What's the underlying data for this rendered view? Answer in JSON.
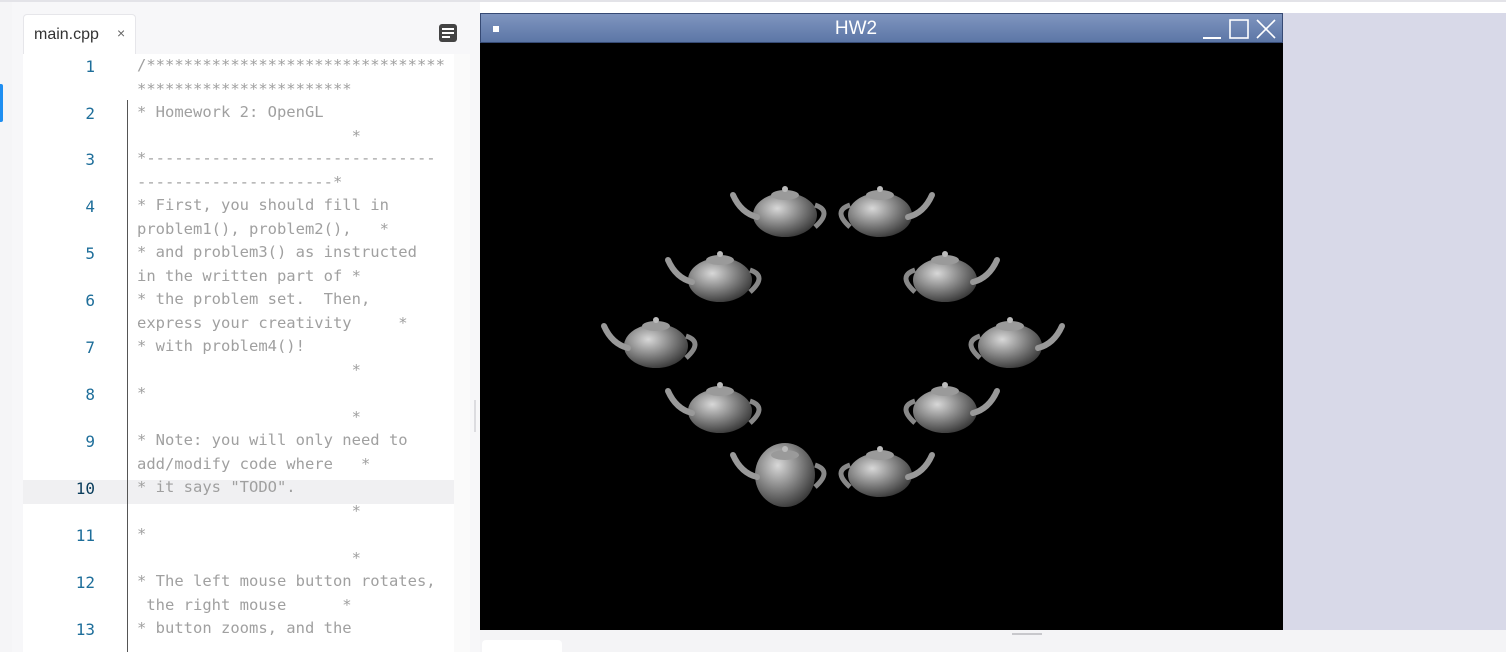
{
  "editor": {
    "tab_title": "main.cpp",
    "tab_close": "×",
    "outline_icon": "outline-icon",
    "active_line": "10",
    "lines": [
      {
        "num": "1",
        "text": "/********************************\n***********************"
      },
      {
        "num": "2",
        "text": "* Homework 2: OpenGL\n                       *"
      },
      {
        "num": "3",
        "text": "*-------------------------------\n---------------------*"
      },
      {
        "num": "4",
        "text": "* First, you should fill in\nproblem1(), problem2(),   *"
      },
      {
        "num": "5",
        "text": "* and problem3() as instructed\nin the written part of *"
      },
      {
        "num": "6",
        "text": "* the problem set.  Then,\nexpress your creativity     *"
      },
      {
        "num": "7",
        "text": "* with problem4()!\n                       *"
      },
      {
        "num": "8",
        "text": "*\n                       *"
      },
      {
        "num": "9",
        "text": "* Note: you will only need to\nadd/modify code where   *"
      },
      {
        "num": "10",
        "text": "* it says \"TODO\".\n                       *"
      },
      {
        "num": "11",
        "text": "*\n                       *"
      },
      {
        "num": "12",
        "text": "* The left mouse button rotates,\n the right mouse      *"
      },
      {
        "num": "13",
        "text": "* button zooms, and the\n"
      }
    ]
  },
  "window": {
    "title": "HW2",
    "minimize_icon": "minimize-icon",
    "maximize_icon": "maximize-icon",
    "close_icon": "close-icon",
    "scene": "teapot-ring",
    "teapot_count": 10,
    "background_color": "#000000",
    "teapot_color": "#8a8a8a"
  },
  "colors": {
    "line_number": "#1e6e9a",
    "comment_text": "#a0a0a0",
    "titlebar": "#6a82b0",
    "accent": "#1f8ef1"
  }
}
